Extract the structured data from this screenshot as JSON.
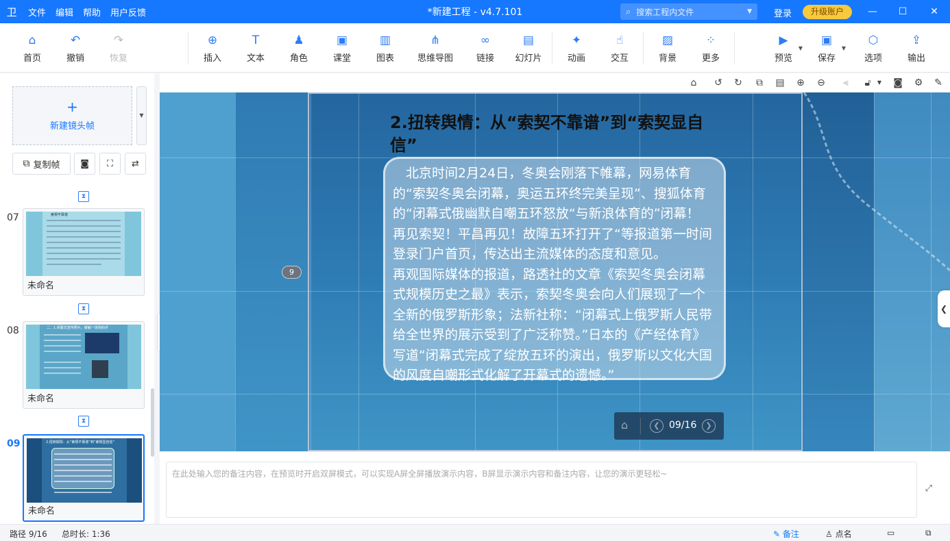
{
  "app": {
    "logo": "卫",
    "menu": [
      "文件",
      "编辑",
      "帮助",
      "用户反馈"
    ],
    "title": "*新建工程 - v4.7.101",
    "search_placeholder": "搜索工程内文件",
    "login": "登录",
    "upgrade": "升级账户",
    "window_buttons": [
      "—",
      "☐",
      "✕"
    ]
  },
  "toolbar": {
    "items": [
      {
        "label": "首页",
        "icon": "home-icon",
        "glyph": "⌂"
      },
      {
        "label": "撤销",
        "icon": "undo-icon",
        "glyph": "↶"
      },
      {
        "label": "恢复",
        "icon": "redo-icon",
        "glyph": "↷"
      },
      {
        "label": "插入",
        "icon": "insert-icon",
        "glyph": "⊕"
      },
      {
        "label": "文本",
        "icon": "text-icon",
        "glyph": "T"
      },
      {
        "label": "角色",
        "icon": "role-icon",
        "glyph": "♟"
      },
      {
        "label": "课堂",
        "icon": "classroom-icon",
        "glyph": "▣"
      },
      {
        "label": "图表",
        "icon": "chart-icon",
        "glyph": "▥"
      },
      {
        "label": "思维导图",
        "icon": "mindmap-icon",
        "glyph": "⋔"
      },
      {
        "label": "链接",
        "icon": "link-icon",
        "glyph": "∞"
      },
      {
        "label": "幻灯片",
        "icon": "slide-icon",
        "glyph": "▤"
      },
      {
        "label": "动画",
        "icon": "animation-icon",
        "glyph": "✦"
      },
      {
        "label": "交互",
        "icon": "interact-icon",
        "glyph": "☝"
      },
      {
        "label": "背景",
        "icon": "background-icon",
        "glyph": "▨"
      },
      {
        "label": "更多",
        "icon": "more-icon",
        "glyph": "⁘"
      },
      {
        "label": "预览",
        "icon": "preview-icon",
        "glyph": "▶"
      },
      {
        "label": "保存",
        "icon": "save-icon",
        "glyph": "▾"
      },
      {
        "label": "选项",
        "icon": "options-icon",
        "glyph": "⬡"
      },
      {
        "label": "输出",
        "icon": "export-icon",
        "glyph": "⇪"
      }
    ]
  },
  "left_panel": {
    "new_frame": "新建镜头帧",
    "copy_frame": "复制帧",
    "slides": [
      {
        "number": "07",
        "name": "未命名",
        "thumb_title": "索契不靠谱"
      },
      {
        "number": "08",
        "name": "未命名",
        "thumb_title": "二、1.闭幕式宣传照片，缓解一场场的评"
      },
      {
        "number": "09",
        "name": "未命名",
        "thumb_title": "2.扭转舆情：从“索契不靠谱”到“索契显自信”"
      }
    ]
  },
  "canvas": {
    "frame_badge": "9",
    "slide_title": "2.扭转舆情：从“索契不靠谱”到“索契显自信”",
    "body_p1": "北京时间2月24日，冬奥会刚落下帷幕，网易体育的“索契冬奥会闭幕，奥运五环终完美呈现”、搜狐体育的“闭幕式俄幽默自嘲五环怒放“与新浪体育的”闭幕！再见索契！平昌再见！故障五环打开了“等报道第一时间登录门户首页，传达出主流媒体的态度和意见。",
    "body_p2": "再观国际媒体的报道，路透社的文章《索契冬奥会闭幕式规模历史之最》表示，索契冬奥会向人们展现了一个全新的俄罗斯形象；法新社称：“闭幕式上俄罗斯人民带给全世界的展示受到了广泛称赞。”日本的《产经体育》写道“闭幕式完成了绽放五环的演出，俄罗斯以文化大国的风度自嘲形式化解了开幕式的遗憾。”",
    "nav_counter": "09/16"
  },
  "notes": {
    "placeholder": "在此处输入您的备注内容，在预览时开启双屏模式，可以实现A屏全屏播放演示内容，B屏显示演示内容和备注内容，让您的演示更轻松~"
  },
  "status": {
    "path": "路径 9/16",
    "duration": "总时长: 1:36",
    "notes_btn": "备注",
    "rollcall_btn": "点名"
  },
  "colors": {
    "accent": "#1677ff",
    "upgrade": "#f7c93c",
    "canvas_bg": "#3a86b8"
  }
}
